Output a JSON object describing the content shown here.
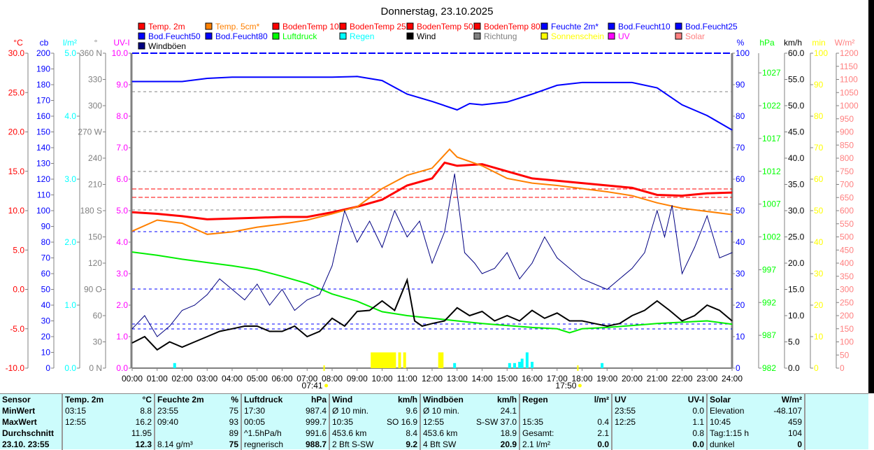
{
  "chart_data": {
    "type": "line",
    "title": "Donnerstag, 23.10.2025",
    "legend": [
      {
        "label": "Temp. 2m",
        "color": "#ff0000"
      },
      {
        "label": "Temp. 5cm*",
        "color": "#ff8000"
      },
      {
        "label": "BodenTemp 10",
        "color": "#ff0000"
      },
      {
        "label": "BodenTemp 25",
        "color": "#ff0000"
      },
      {
        "label": "BodenTemp 50",
        "color": "#ff0000"
      },
      {
        "label": "BodenTemp 80",
        "color": "#ff0000"
      },
      {
        "label": "Feuchte 2m*",
        "color": "#0000ff"
      },
      {
        "label": "Bod.Feucht10",
        "color": "#0000ff"
      },
      {
        "label": "Bod.Feucht25",
        "color": "#0000ff"
      },
      {
        "label": "Bod.Feucht50",
        "color": "#0000ff"
      },
      {
        "label": "Bod.Feucht80",
        "color": "#0000ff"
      },
      {
        "label": "Luftdruck",
        "color": "#00ff00"
      },
      {
        "label": "Regen",
        "color": "#00ffff"
      },
      {
        "label": "Wind",
        "color": "#000000"
      },
      {
        "label": "Richtung",
        "color": "#808080"
      },
      {
        "label": "Sonnenschein",
        "color": "#ffff00"
      },
      {
        "label": "UV",
        "color": "#ff00ff"
      },
      {
        "label": "Solar",
        "color": "#ff8080"
      },
      {
        "label": "Windböen",
        "color": "#000080"
      }
    ],
    "x_ticks": [
      "00:00",
      "01:00",
      "02:00",
      "03:00",
      "04:00",
      "05:00",
      "06:00",
      "07:00",
      "08:00",
      "09:00",
      "10:00",
      "11:00",
      "12:00",
      "13:00",
      "14:00",
      "15:00",
      "16:00",
      "17:00",
      "18:00",
      "19:00",
      "20:00",
      "21:00",
      "22:00",
      "23:00",
      "24:00"
    ],
    "sunrise": {
      "label": "07:41",
      "hour": 7.68
    },
    "sunset": {
      "label": "17:50",
      "hour": 17.83
    },
    "axes_left": [
      {
        "unit": "°C",
        "color": "#ff0000",
        "min": -10,
        "max": 30,
        "ticks": [
          "-10.0",
          "-5.0",
          "0.0",
          "5.0",
          "10.0",
          "15.0",
          "20.0",
          "25.0",
          "30.0"
        ]
      },
      {
        "unit": "cb",
        "color": "#0000ff",
        "min": 0,
        "max": 200,
        "ticks": [
          "0",
          "10",
          "20",
          "30",
          "40",
          "50",
          "60",
          "70",
          "80",
          "90",
          "100",
          "110",
          "120",
          "130",
          "140",
          "150",
          "160",
          "170",
          "180",
          "190",
          "200"
        ]
      },
      {
        "unit": "l/m²",
        "color": "#00ffff",
        "min": 0,
        "max": 5,
        "ticks": [
          "0.0",
          "1.0",
          "2.0",
          "3.0",
          "4.0",
          "5.0"
        ]
      },
      {
        "unit": "°",
        "color": "#808080",
        "min": 0,
        "max": 360,
        "ticks": [
          "0   N",
          "30",
          "60",
          "90  O",
          "120",
          "150",
          "180 S",
          "210",
          "240",
          "270 W",
          "300",
          "330",
          "360 N"
        ]
      },
      {
        "unit": "UV-I",
        "color": "#ff00ff",
        "min": 0,
        "max": 10,
        "ticks": [
          "0.0",
          "1.0",
          "2.0",
          "3.0",
          "4.0",
          "5.0",
          "6.0",
          "7.0",
          "8.0",
          "9.0",
          "10.0"
        ]
      }
    ],
    "axes_right": [
      {
        "unit": "%",
        "color": "#0000ff",
        "min": 0,
        "max": 100,
        "ticks": [
          "0",
          "10",
          "20",
          "30",
          "40",
          "50",
          "60",
          "70",
          "80",
          "90",
          "100"
        ],
        "values": [
          0,
          10,
          20,
          30,
          40,
          50,
          60,
          70,
          80,
          90,
          100
        ]
      },
      {
        "unit": "hPa",
        "color": "#00ff00",
        "min": 982,
        "max": 1030,
        "ticks": [
          "982",
          "987",
          "992",
          "997",
          "1002",
          "1007",
          "1012",
          "1017",
          "1022",
          "1027"
        ],
        "values": [
          982,
          987,
          992,
          997,
          1002,
          1007,
          1012,
          1017,
          1022,
          1027
        ]
      },
      {
        "unit": "km/h",
        "color": "#000000",
        "min": 0,
        "max": 60,
        "ticks": [
          "0.0",
          "5.0",
          "10.0",
          "15.0",
          "20.0",
          "25.0",
          "30.0",
          "35.0",
          "40.0",
          "45.0",
          "50.0",
          "55.0",
          "60.0"
        ],
        "values": [
          0,
          5,
          10,
          15,
          20,
          25,
          30,
          35,
          40,
          45,
          50,
          55,
          60
        ]
      },
      {
        "unit": "min",
        "color": "#ffff00",
        "min": 0,
        "max": 100,
        "ticks": [
          "0",
          "10",
          "20",
          "30",
          "40",
          "50",
          "60",
          "70",
          "80",
          "90",
          "100"
        ],
        "values": [
          0,
          10,
          20,
          30,
          40,
          50,
          60,
          70,
          80,
          90,
          100
        ]
      },
      {
        "unit": "W/m²",
        "color": "#ff8080",
        "min": 0,
        "max": 1200,
        "ticks": [
          "0",
          "50",
          "100",
          "150",
          "200",
          "250",
          "300",
          "350",
          "400",
          "450",
          "500",
          "550",
          "600",
          "650",
          "700",
          "750",
          "800",
          "850",
          "900",
          "950",
          "1000",
          "1050",
          "1100",
          "1150",
          "1200"
        ],
        "values": [
          0,
          50,
          100,
          150,
          200,
          250,
          300,
          350,
          400,
          450,
          500,
          550,
          600,
          650,
          700,
          750,
          800,
          850,
          900,
          950,
          1000,
          1050,
          1100,
          1150,
          1200
        ]
      }
    ],
    "series": [
      {
        "name": "Temp. 2m",
        "axis": "°C",
        "color": "#ff0000",
        "width": 3,
        "x": [
          0,
          1,
          2,
          3,
          4,
          5,
          6,
          7,
          8,
          9,
          10,
          11,
          12,
          12.5,
          13,
          14,
          15,
          16,
          17,
          18,
          19,
          20,
          21,
          22,
          23,
          24
        ],
        "y": [
          9.8,
          9.6,
          9.3,
          8.9,
          9.0,
          9.1,
          9.2,
          9.2,
          9.8,
          10.5,
          11.4,
          13.2,
          14.1,
          16.1,
          15.7,
          15.9,
          15.0,
          14.1,
          13.8,
          13.5,
          13.2,
          12.9,
          12.0,
          11.9,
          12.2,
          12.3
        ]
      },
      {
        "name": "Temp. 5cm*",
        "axis": "°C",
        "color": "#ff8000",
        "width": 2,
        "x": [
          0,
          1,
          2,
          3,
          4,
          5,
          6,
          7,
          8,
          9,
          10,
          11,
          12,
          12.7,
          13,
          14,
          15,
          16,
          17,
          18,
          19,
          20,
          21,
          22,
          23,
          24
        ],
        "y": [
          7.4,
          8.8,
          8.4,
          7.0,
          7.3,
          7.9,
          8.3,
          8.8,
          9.6,
          10.5,
          12.8,
          14.5,
          15.4,
          17.8,
          16.8,
          15.7,
          14.1,
          13.5,
          13.2,
          12.8,
          12.4,
          11.9,
          11.0,
          10.3,
          9.9,
          9.5
        ]
      },
      {
        "name": "Feuchte 2m*",
        "axis": "%",
        "color": "#0000ff",
        "width": 2,
        "x": [
          0,
          1,
          2,
          3,
          4,
          5,
          6,
          7,
          8,
          9,
          10,
          11,
          12,
          13,
          13.5,
          14,
          15,
          16,
          17,
          18,
          19,
          20,
          21,
          22,
          23,
          24
        ],
        "y": [
          91,
          91,
          91,
          92,
          92.4,
          92.4,
          92.4,
          92.4,
          92.4,
          92.6,
          91.3,
          87,
          84.7,
          82,
          84,
          83.6,
          84.5,
          87,
          89.8,
          90.7,
          90.7,
          90.7,
          89,
          83.6,
          80.2,
          75.6
        ]
      },
      {
        "name": "Luftdruck",
        "axis": "hPa",
        "color": "#00ee00",
        "width": 2,
        "x": [
          0,
          1,
          2,
          3,
          4,
          5,
          6,
          7,
          8,
          9,
          10,
          11,
          12,
          13,
          14,
          15,
          16,
          17,
          17.5,
          18,
          19,
          20,
          21,
          22,
          23,
          24
        ],
        "y": [
          999.7,
          999.2,
          998.6,
          998.1,
          997.6,
          997.0,
          996.0,
          994.9,
          993.3,
          992.2,
          990.6,
          990.0,
          989.6,
          989.2,
          988.8,
          988.5,
          988.2,
          988.0,
          987.4,
          988.0,
          988.2,
          988.5,
          988.8,
          989.0,
          989.2,
          988.7
        ]
      },
      {
        "name": "Windböen",
        "axis": "km/h",
        "color": "#000080",
        "width": 1,
        "x": [
          0,
          0.5,
          1,
          1.5,
          2,
          2.5,
          3,
          3.5,
          4,
          4.5,
          5,
          5.5,
          6,
          6.5,
          7,
          7.5,
          8,
          8.5,
          9,
          9.5,
          10,
          10.5,
          11,
          11.5,
          12,
          12.5,
          12.9,
          13.3,
          13.7,
          14,
          14.5,
          15,
          15.5,
          16,
          16.5,
          17,
          17.5,
          18,
          18.5,
          19,
          19.5,
          20,
          20.5,
          21,
          21.3,
          21.6,
          22,
          22.5,
          23,
          23.5,
          24
        ],
        "y": [
          7.5,
          10,
          6,
          8,
          11,
          12,
          14,
          17,
          15,
          13,
          16,
          12,
          15,
          11,
          13,
          14,
          19.5,
          30,
          24,
          28,
          23,
          30,
          25,
          28,
          20,
          26,
          37,
          22,
          20,
          18,
          19,
          22,
          17,
          20,
          25,
          21,
          19,
          17,
          16,
          15,
          17,
          19,
          22,
          30,
          25,
          31,
          18,
          23,
          29,
          21,
          22
        ]
      },
      {
        "name": "Wind",
        "axis": "km/h",
        "color": "#000000",
        "width": 2,
        "x": [
          0,
          0.5,
          1,
          1.5,
          2,
          2.5,
          3,
          3.5,
          4,
          4.5,
          5,
          5.5,
          6,
          6.5,
          7,
          7.5,
          8,
          8.5,
          9,
          9.5,
          10,
          10.5,
          11,
          11.3,
          11.6,
          12,
          12.5,
          13,
          13.5,
          14,
          14.5,
          15,
          15.5,
          16,
          16.5,
          17,
          17.5,
          18,
          18.5,
          19,
          19.5,
          20,
          20.5,
          21,
          21.5,
          22,
          22.5,
          23,
          23.5,
          24
        ],
        "y": [
          4.8,
          6,
          3.5,
          5,
          4,
          5,
          6,
          7,
          7.5,
          8,
          8,
          7,
          7,
          8,
          6,
          7,
          9.5,
          8,
          10.8,
          11,
          12.8,
          11,
          16.8,
          9,
          8,
          8.5,
          9,
          11.5,
          10,
          10.8,
          9,
          10,
          9,
          11,
          9.5,
          10.5,
          9,
          9,
          8.5,
          8,
          8.5,
          10,
          11,
          12.8,
          11,
          9,
          10,
          12,
          11,
          9
        ]
      },
      {
        "name": "Regen",
        "axis": "l/m²",
        "color": "#00ffff",
        "bars": true,
        "x": [
          1.7,
          12.9,
          15.1,
          15.3,
          15.5,
          15.6,
          15.8,
          16.0,
          18.8
        ],
        "y": [
          0.08,
          0.08,
          0.08,
          0.08,
          0.1,
          0.15,
          0.25,
          0.1,
          0.08
        ]
      },
      {
        "name": "Sonnenschein",
        "axis": "min",
        "color": "#ffff00",
        "bars": true,
        "x": [
          9.6,
          9.7,
          9.8,
          9.9,
          10.0,
          10.1,
          10.2,
          10.3,
          10.4,
          10.5,
          10.7,
          10.9,
          12.3,
          12.4
        ],
        "y": [
          5,
          5,
          5,
          5,
          5,
          5,
          5,
          5,
          5,
          5,
          5,
          5,
          5,
          5
        ]
      }
    ]
  },
  "stats": {
    "header": [
      "Sensor",
      "Temp. 2m",
      "°C",
      "Feuchte 2m",
      "%",
      "Luftdruck",
      "hPa",
      "Wind",
      "km/h",
      "Windböen",
      "km/h",
      "Regen",
      "l/m²",
      "UV",
      "UV-I",
      "Solar",
      "W/m²"
    ],
    "rows": [
      [
        "MinWert",
        "03:15",
        "8.8",
        "23:55",
        "75",
        "17:30",
        "987.4",
        "Ø 10 min.",
        "9.6",
        "Ø 10 min.",
        "24.1",
        "",
        "",
        "23:55",
        "0.0",
        "Elevation",
        "-48.107"
      ],
      [
        "MaxWert",
        "12:55",
        "16.2",
        "09:40",
        "93",
        "00:05",
        "999.7",
        "10:35",
        "SO 16.9",
        "12:55",
        "S-SW 37.0",
        "15:35",
        "0.4",
        "12:25",
        "1.1",
        "10:45",
        "459"
      ],
      [
        "Durchschnitt",
        "",
        "11.95",
        "",
        "89",
        "^1.5hPa/h",
        "991.6",
        "453.6 km",
        "8.4",
        "453.6 km",
        "18.9",
        "Gesamt:",
        "2.1",
        "",
        "0.8",
        "Tag:1:15 h",
        "104"
      ],
      [
        "23.10. 23:55",
        "",
        "12.3",
        "8.14 g/m³",
        "75",
        "regnerisch",
        "988.7",
        "2 Bft S-SW",
        "9.2",
        "4 Bft SW",
        "20.9",
        "2.1 l/m²",
        "0.0",
        "",
        "0.0",
        "dunkel",
        "0"
      ]
    ]
  }
}
